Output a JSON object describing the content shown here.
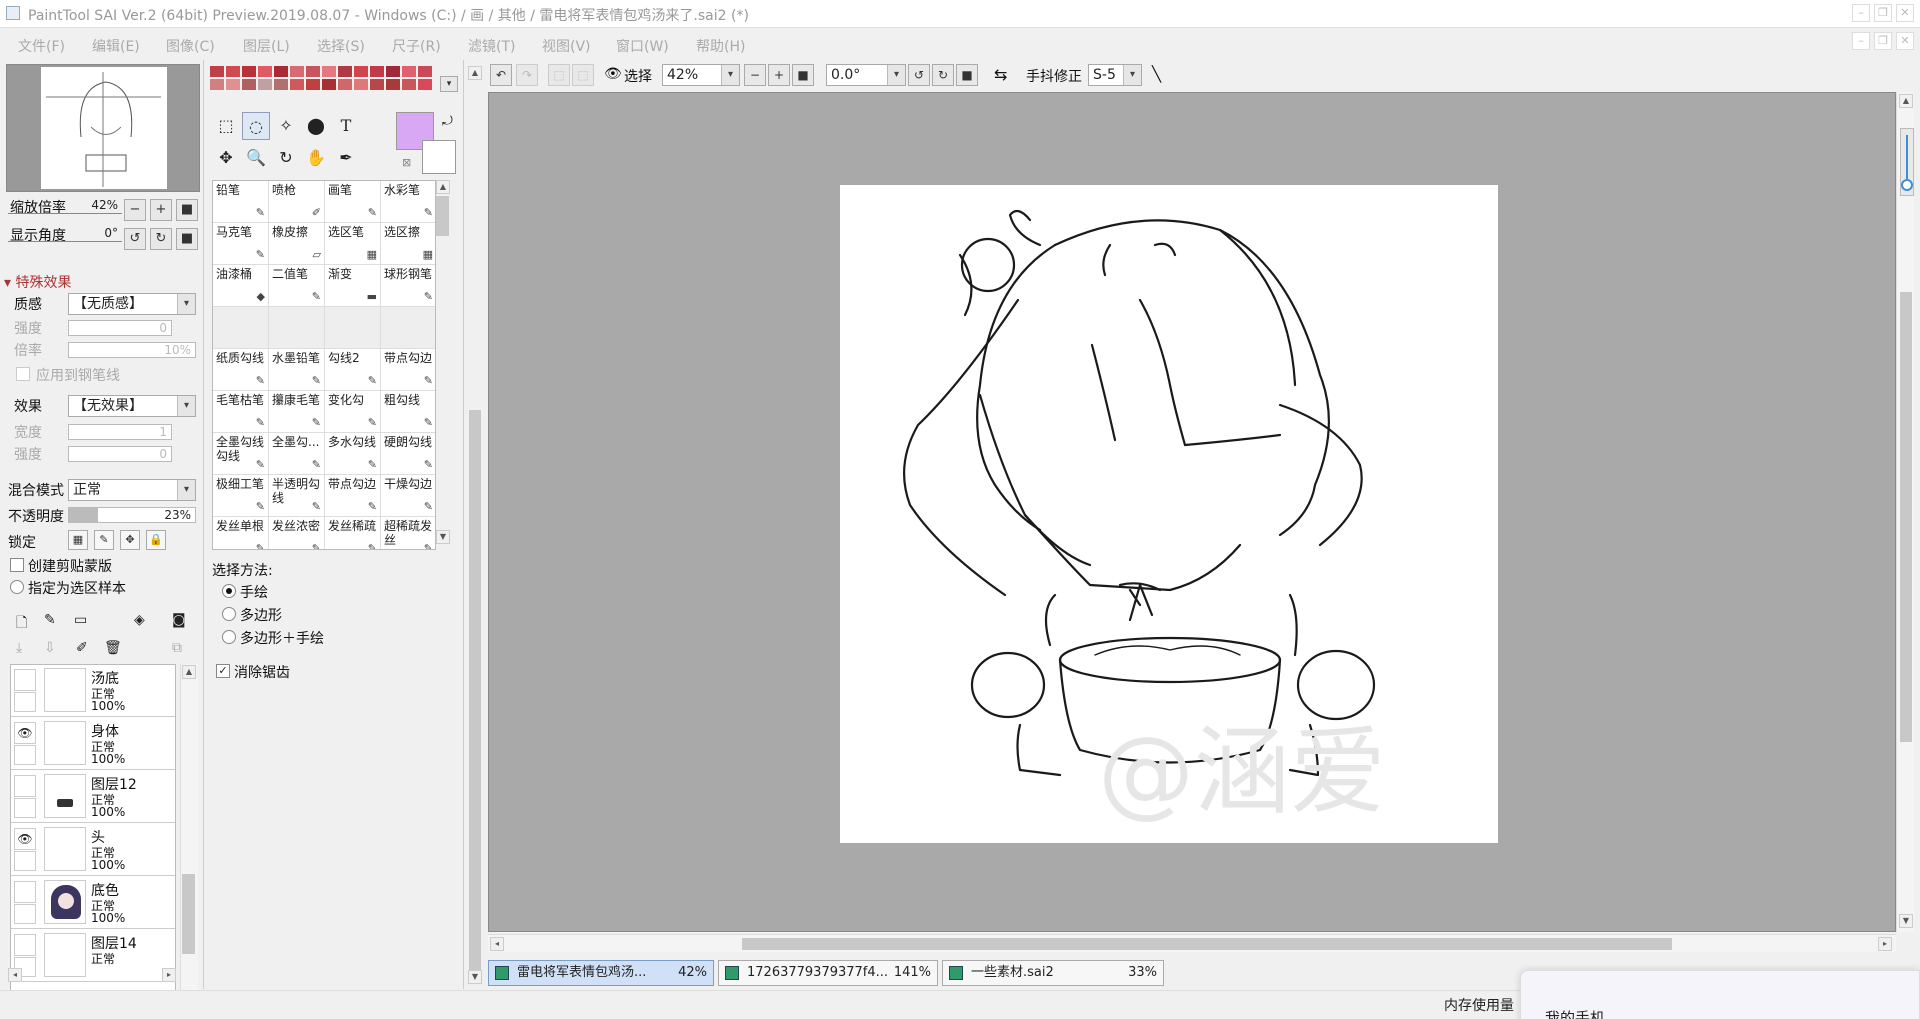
{
  "window": {
    "title": "PaintTool SAI Ver.2 (64bit) Preview.2019.08.07 - Windows (C:) / 画 / 其他 / 雷电将军表情包鸡汤来了.sai2 (*)",
    "buttons": [
      "–",
      "❐",
      "✕"
    ]
  },
  "menubar": {
    "items": [
      "文件(F)",
      "编辑(E)",
      "图像(C)",
      "图层(L)",
      "选择(S)",
      "尺子(R)",
      "滤镜(T)",
      "视图(V)",
      "窗口(W)",
      "帮助(H)"
    ]
  },
  "navigator": {
    "zoom_label": "缩放倍率",
    "zoom_value": "42%",
    "angle_label": "显示角度",
    "angle_value": "0°"
  },
  "special_effects": {
    "header": "特殊效果",
    "texture_label": "质感",
    "texture_value": "【无质感】",
    "strength_label": "强度",
    "strength_value": "0",
    "scale_label": "倍率",
    "scale_value": "10%",
    "apply_pen_label": "应用到钢笔线",
    "effect_label": "效果",
    "effect_value": "【无效果】",
    "width_label": "宽度",
    "width_value": "1",
    "effect_strength_label": "强度",
    "effect_strength_value": "0"
  },
  "layer_props": {
    "blend_label": "混合模式",
    "blend_value": "正常",
    "opacity_label": "不透明度",
    "opacity_value": "23%",
    "opacity_fraction": 0.23,
    "lock_label": "锁定",
    "clip_label": "创建剪贴蒙版",
    "sample_label": "指定为选区样本"
  },
  "layers": [
    {
      "name": "汤底",
      "mode": "正常",
      "opacity": "100%",
      "visible": false
    },
    {
      "name": "身体",
      "mode": "正常",
      "opacity": "100%",
      "visible": true
    },
    {
      "name": "图层12",
      "mode": "正常",
      "opacity": "100%",
      "visible": false
    },
    {
      "name": "头",
      "mode": "正常",
      "opacity": "100%",
      "visible": true
    },
    {
      "name": "底色",
      "mode": "正常",
      "opacity": "100%",
      "visible": false
    },
    {
      "name": "图层14",
      "mode": "正常",
      "opacity": "",
      "visible": false
    }
  ],
  "palette": {
    "colors": [
      "#c0404a",
      "#d04a54",
      "#b8323c",
      "#e05a66",
      "#a82a34",
      "#d86a74",
      "#c85460",
      "#e87880",
      "#b03a44",
      "#d04450",
      "#c03a48",
      "#a02838",
      "#e06070",
      "#c84a58",
      "#d08080",
      "#e09090",
      "#b06060",
      "#c0a0a0",
      "#b07070",
      "#d05a5a",
      "#c04040",
      "#a83030",
      "#d06868",
      "#e07878",
      "#b84848",
      "#a83a3a",
      "#c85858",
      "#d84a5a"
    ]
  },
  "current_color": {
    "primary": "#d9a8f5",
    "secondary": "#ffffff"
  },
  "tools": [
    "selection-rect-tool",
    "lasso-tool",
    "magic-wand-tool",
    "shape-tool",
    "text-tool",
    "move-tool",
    "zoom-tool",
    "rotate-tool",
    "hand-tool",
    "eyedropper-tool"
  ],
  "tool_text_label": "T",
  "brushes": [
    {
      "label": "铅笔",
      "icon": "✎"
    },
    {
      "label": "喷枪",
      "icon": "✐"
    },
    {
      "label": "画笔",
      "icon": "✎"
    },
    {
      "label": "水彩笔",
      "icon": "✎"
    },
    {
      "label": "马克笔",
      "icon": "✎"
    },
    {
      "label": "橡皮擦",
      "icon": "▱"
    },
    {
      "label": "选区笔",
      "icon": "▦"
    },
    {
      "label": "选区擦",
      "icon": "▦"
    },
    {
      "label": "油漆桶",
      "icon": "◆"
    },
    {
      "label": "二值笔",
      "icon": "✎"
    },
    {
      "label": "渐变",
      "icon": "▬"
    },
    {
      "label": "球形钢笔",
      "icon": "✎"
    },
    {
      "label": "",
      "icon": ""
    },
    {
      "label": "",
      "icon": ""
    },
    {
      "label": "",
      "icon": ""
    },
    {
      "label": "",
      "icon": ""
    },
    {
      "label": "纸质勾线",
      "icon": "✎"
    },
    {
      "label": "水墨铅笔",
      "icon": "✎"
    },
    {
      "label": "勾线2",
      "icon": "✎"
    },
    {
      "label": "带点勾边",
      "icon": "✎"
    },
    {
      "label": "毛笔枯笔",
      "icon": "✎"
    },
    {
      "label": "攥康毛笔",
      "icon": "✎"
    },
    {
      "label": "变化勾",
      "icon": "✎"
    },
    {
      "label": "粗勾线",
      "icon": "✎"
    },
    {
      "label": "全墨勾线勾线",
      "icon": "✎"
    },
    {
      "label": "全墨勾...",
      "icon": "✎"
    },
    {
      "label": "多水勾线",
      "icon": "✎"
    },
    {
      "label": "硬朗勾线",
      "icon": "✎"
    },
    {
      "label": "极细工笔",
      "icon": "✎"
    },
    {
      "label": "半透明勾线",
      "icon": "✎"
    },
    {
      "label": "带点勾边",
      "icon": "✎"
    },
    {
      "label": "干燥勾边",
      "icon": "✎"
    },
    {
      "label": "发丝单根",
      "icon": "✎"
    },
    {
      "label": "发丝浓密",
      "icon": "✎"
    },
    {
      "label": "发丝稀疏",
      "icon": "✎"
    },
    {
      "label": "超稀疏发丝",
      "icon": "✎"
    }
  ],
  "selection_method": {
    "title": "选择方法:",
    "options": [
      "手绘",
      "多边形",
      "多边形＋手绘"
    ],
    "selected": 0,
    "antialias_label": "消除锯齿",
    "antialias_checked": true
  },
  "toolbar": {
    "select_label": "选择",
    "zoom_value": "42%",
    "angle_value": "0.0°",
    "stabilizer_label": "手抖修正",
    "stabilizer_value": "S-5"
  },
  "canvas": {
    "watermark": "@涵爱"
  },
  "tabs": [
    {
      "name": "雷电将军表情包鸡汤...",
      "zoom": "42%",
      "active": true
    },
    {
      "name": "17263779379377f4...",
      "zoom": "141%",
      "active": false
    },
    {
      "name": "一些素材.sai2",
      "zoom": "33%",
      "active": false
    }
  ],
  "status": {
    "memory_label": "内存使用量",
    "popup_text": "我的手机"
  }
}
